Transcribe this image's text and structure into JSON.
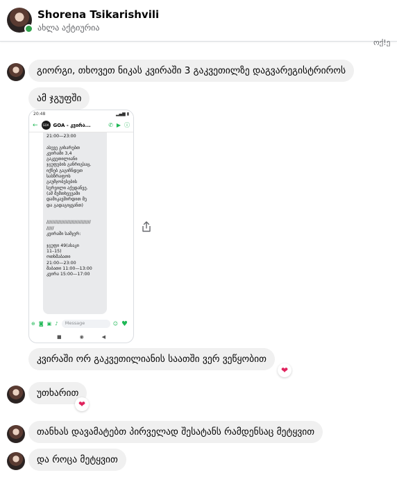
{
  "header": {
    "name": "Shorena Tsikarishvili",
    "status": "ახლა აქტიურია"
  },
  "seen_corner_text": "ოქ!ე",
  "messages": [
    {
      "id": "m1",
      "text": "გიორგი, თხოვეთ ნიკას კვირაში 3 გაკვეთილზე დაგვარეგისტრიროს"
    },
    {
      "id": "m2",
      "text": "ამ ჯგუფში"
    },
    {
      "id": "m3",
      "text": "კვირაში ორ გაკვეთილიანის საათში ვერ ვეწყობით",
      "reaction": "❤"
    },
    {
      "id": "m4",
      "text": "უთხარით",
      "reaction": "❤"
    },
    {
      "id": "m5",
      "text": "თანხას დავამატებთ პირველად შესატანს რამდენსაც მეტყვით"
    },
    {
      "id": "m6",
      "text": "და როცა მეტყვით"
    }
  ],
  "attachment": {
    "status_time": "20:48",
    "chat_title": "GOA - კვირა...",
    "logo_text": "GOA",
    "message_text": "21:00—23:00\n\nასევე გიხარებთ\nკვირაში 3,4\nგაკვეთილიანი\nჯგუფების განრიგსაც,\nიქნებ გაგიჩნდეთ\nსასწრაფოს\nგაუმჯობესების\nსურვილი აქედანვე.\n(ამ შემთხვევაში\nდამიკავშირდით მე\nდა გადაგიყვანთ)\n\n\n//////////////////////////////\n/////\nკვირაში სამჯერ:\n\nჯგუფი 49(ასაკი\n11–15)\nოთხშაბათი\n21:00—23:00\nშაბათი 11:00—13:00\nკვირა 15:00—17:00",
    "composer_placeholder": "Message"
  }
}
